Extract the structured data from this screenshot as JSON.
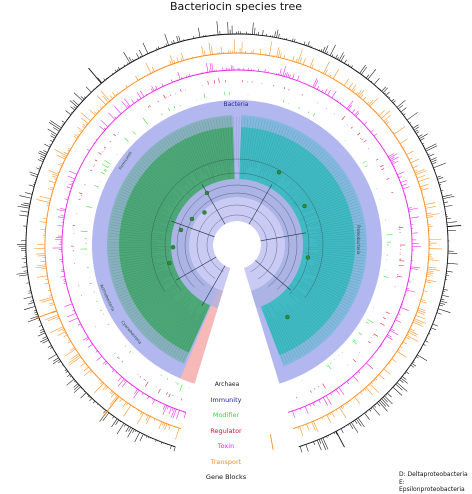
{
  "title": "Bacteriocin species tree",
  "clades": {
    "bacteria": "Bacteria",
    "archaea": "Archaea",
    "firmicutes": "Firmicutes",
    "actinobacteria": "Actinobacteria",
    "cyanobacteria": "Cyanobacteria",
    "proteobacteria": "Proteobacteria",
    "d_label": "D",
    "e_label": "E"
  },
  "legend": [
    {
      "label": "Immunity",
      "color": "#1a1aaa"
    },
    {
      "label": "Modifier",
      "color": "#33dd33"
    },
    {
      "label": "Regulator",
      "color": "#dd1133"
    },
    {
      "label": "Toxin",
      "color": "#ee22ee"
    },
    {
      "label": "Transport",
      "color": "#ff8c1a"
    },
    {
      "label": "Gene Blocks",
      "color": "#111111"
    }
  ],
  "footnote": {
    "line1": "D: Deltaproteobacteria",
    "line2": "E: Epsilonproteobacteria"
  },
  "colors": {
    "bacteria_band": "#b3b7f0",
    "inner_band": "#c9cbf4",
    "gram_positive": "#3aa660",
    "proteobacteria": "#2bbcbc",
    "archaea": "#f7b8b8",
    "gap": "#ffffff"
  }
}
